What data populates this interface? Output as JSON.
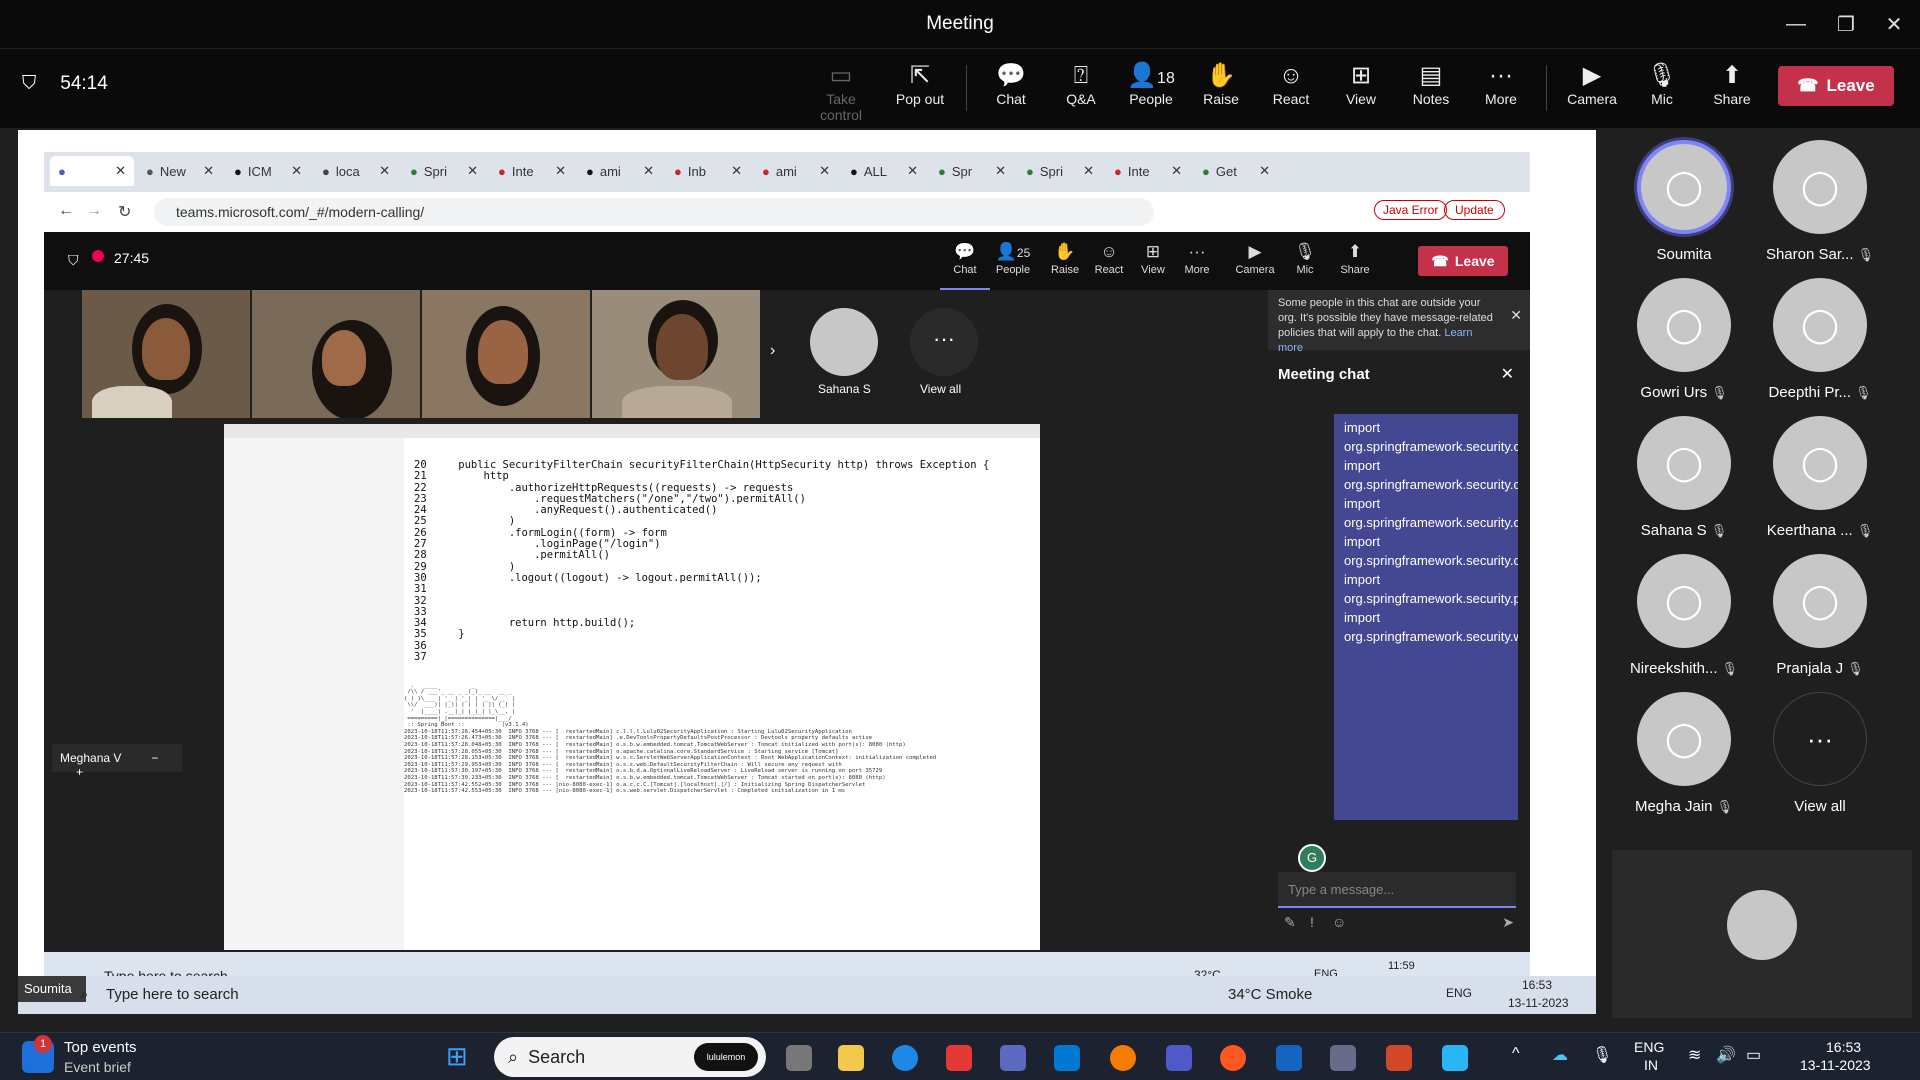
{
  "window": {
    "title": "Meeting"
  },
  "toolbar": {
    "timer": "54:14",
    "take_control": "Take control",
    "pop_out": "Pop out",
    "chat": "Chat",
    "qa": "Q&A",
    "people": "People",
    "people_count": "18",
    "raise": "Raise",
    "react": "React",
    "view": "View",
    "notes": "Notes",
    "more": "More",
    "camera": "Camera",
    "mic": "Mic",
    "share": "Share",
    "leave": "Leave"
  },
  "participants": [
    {
      "name": "Soumita",
      "muted": false
    },
    {
      "name": "Sharon Sar...",
      "muted": true
    },
    {
      "name": "Gowri Urs",
      "muted": true
    },
    {
      "name": "Deepthi Pr...",
      "muted": true
    },
    {
      "name": "Sahana S",
      "muted": true
    },
    {
      "name": "Keerthana ...",
      "muted": true
    },
    {
      "name": "Nireekshith...",
      "muted": true
    },
    {
      "name": "Pranjala J",
      "muted": true
    },
    {
      "name": "Megha Jain",
      "muted": true
    },
    {
      "name": "View all",
      "muted": false
    }
  ],
  "browser": {
    "url": "teams.microsoft.com/_#/modern-calling/",
    "tabs": [
      "",
      "New",
      "ICM",
      "loca",
      "Spri",
      "Inte",
      "ami",
      "Inb",
      "ami",
      "ALL",
      "Spr",
      "Spri",
      "Inte",
      "Get"
    ],
    "error_label": "Java Error",
    "update_label": "Update"
  },
  "inner_meeting": {
    "timer": "27:45",
    "chat": "Chat",
    "people": "People",
    "people_count": "25",
    "raise": "Raise",
    "react": "React",
    "view": "View",
    "more": "More",
    "camera": "Camera",
    "mic": "Mic",
    "share": "Share",
    "leave": "Leave",
    "sahana": "Sahana S",
    "view_all": "View all",
    "presenter": "Meghana V",
    "soumita_tag": "Soumita"
  },
  "chat": {
    "notice": "Some people in this chat are outside your org. It's possible they have message-related policies that will apply to the chat.",
    "learn_more": "Learn more",
    "title": "Meeting chat",
    "message": "import org.springframework.security.config.annotation.web.configuration.EnableWebSecurity; import org.springframework.security.core.userdetails.User; import org.springframework.security.core.userdetails.UserDetails; import org.springframework.security.core.userdetails.UserDetailsService; import org.springframework.security.provisioning.InMemoryUserDetailsManager; import org.springframework.security.web.SecurityFilterChain;",
    "placeholder": "Type a message..."
  },
  "code": {
    "lines": "20     public SecurityFilterChain securityFilterChain(HttpSecurity http) throws Exception {\n21         http\n22             .authorizeHttpRequests((requests) -> requests\n23                 .requestMatchers(\"/one\",\"/two\").permitAll()\n24                 .anyRequest().authenticated()\n25             )\n26             .formLogin((form) -> form\n27                 .loginPage(\"/login\")\n28                 .permitAll()\n29             )\n30             .logout((logout) -> logout.permitAll());\n31 \n32 \n33 \n34             return http.build();\n35     }\n36 \n37"
  },
  "inner_taskbar": {
    "search": "Type here to search",
    "temp": "32°C",
    "lang": "ENG",
    "time": "11:59"
  },
  "outer_taskbar": {
    "search": "Type here to search",
    "weather": "34°C Smoke",
    "lang": "ENG",
    "time": "16:53",
    "date": "13-11-2023"
  },
  "win_taskbar": {
    "events_title": "Top events",
    "events_sub": "Event brief",
    "badge": "1",
    "search": "Search",
    "lulu": "lululemon",
    "lang": "ENG",
    "region": "IN",
    "time": "16:53",
    "date": "13-11-2023"
  }
}
